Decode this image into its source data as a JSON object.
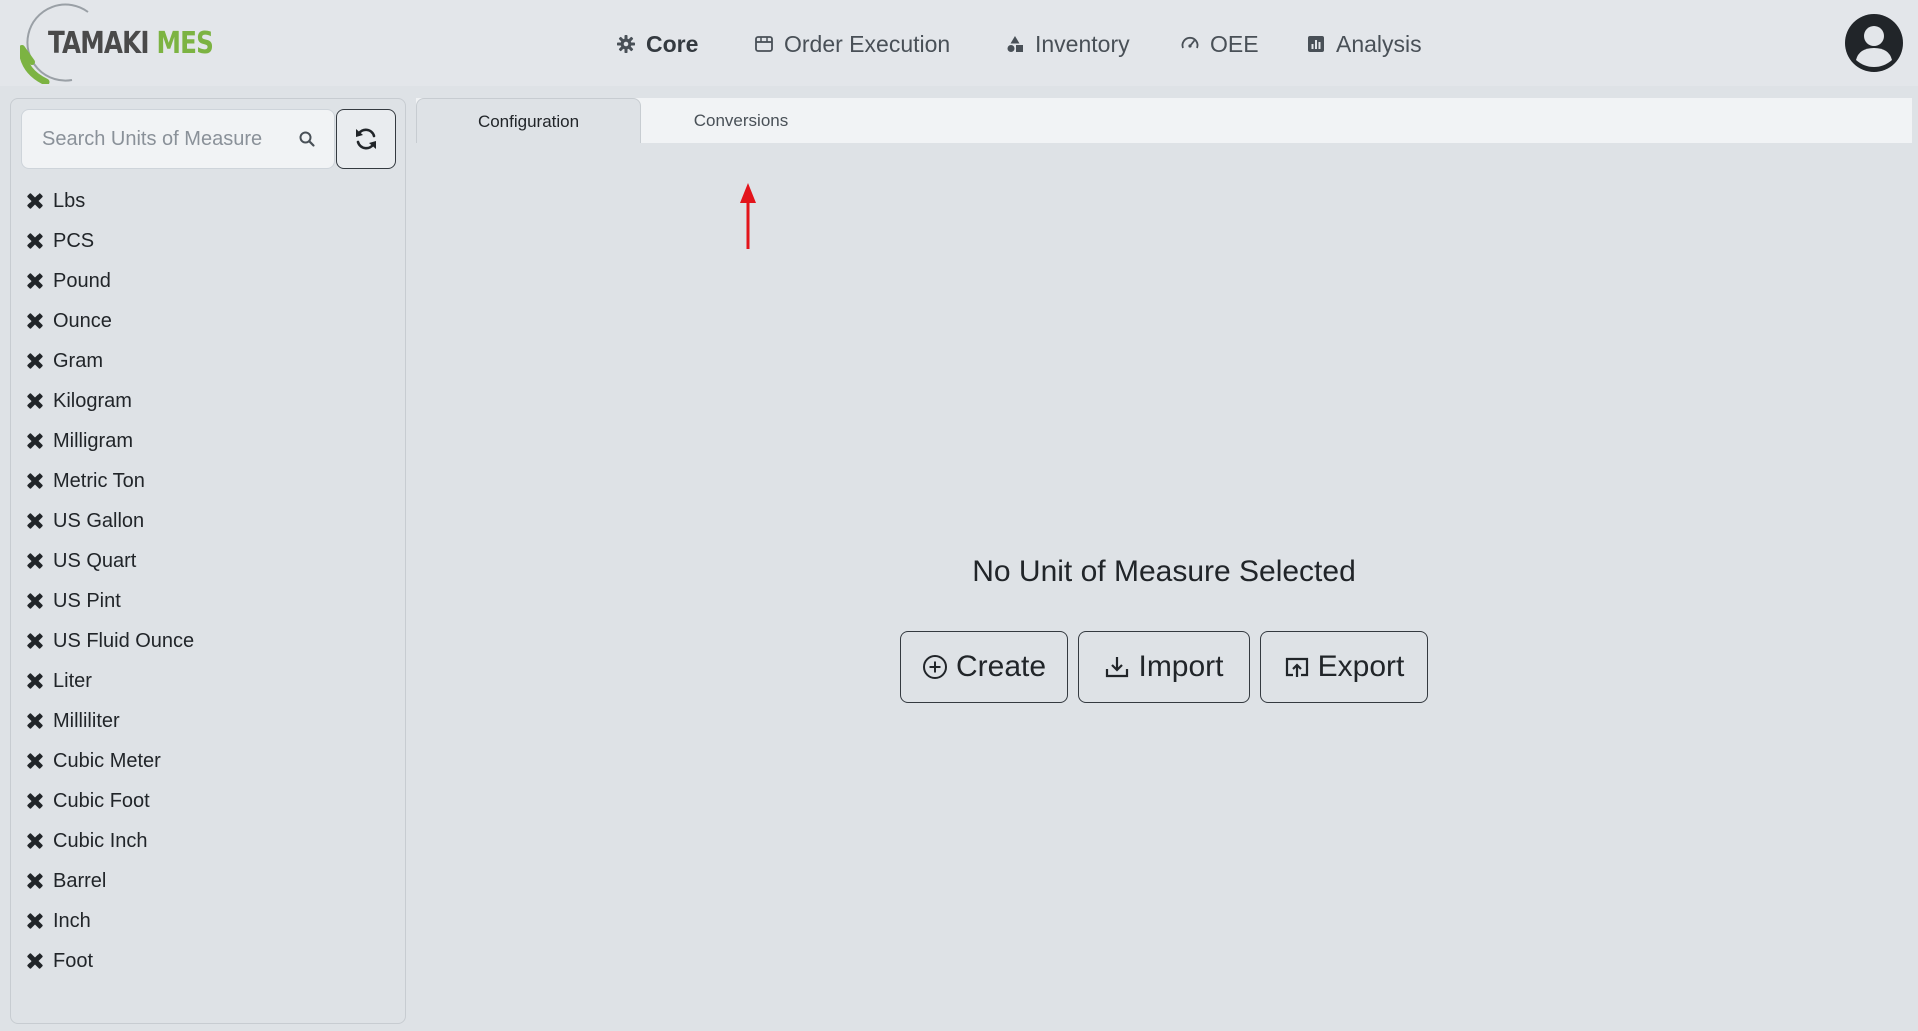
{
  "header": {
    "logo_primary": "TAMAKI",
    "logo_secondary": "MES",
    "nav": [
      {
        "label": "Core",
        "icon": "gear-icon",
        "active": true
      },
      {
        "label": "Order Execution",
        "icon": "calendar-icon",
        "active": false
      },
      {
        "label": "Inventory",
        "icon": "shapes-icon",
        "active": false
      },
      {
        "label": "OEE",
        "icon": "speedometer-icon",
        "active": false
      },
      {
        "label": "Analysis",
        "icon": "bar-chart-icon",
        "active": false
      }
    ],
    "avatar_icon": "user-circle-icon"
  },
  "sidebar": {
    "search_placeholder": "Search Units of Measure",
    "search_icon": "search-icon",
    "refresh_icon": "refresh-icon",
    "item_icon": "ruler-pencil-icon",
    "items": [
      "Lbs",
      "PCS",
      "Pound",
      "Ounce",
      "Gram",
      "Kilogram",
      "Milligram",
      "Metric Ton",
      "US Gallon",
      "US Quart",
      "US Pint",
      "US Fluid Ounce",
      "Liter",
      "Milliliter",
      "Cubic Meter",
      "Cubic Foot",
      "Cubic Inch",
      "Barrel",
      "Inch",
      "Foot"
    ]
  },
  "main": {
    "tabs": [
      {
        "label": "Configuration",
        "active": true
      },
      {
        "label": "Conversions",
        "active": false
      }
    ],
    "empty_title": "No Unit of Measure Selected",
    "actions": {
      "create_label": "Create",
      "import_label": "Import",
      "export_label": "Export"
    },
    "annotation_color": "#e3141b"
  }
}
